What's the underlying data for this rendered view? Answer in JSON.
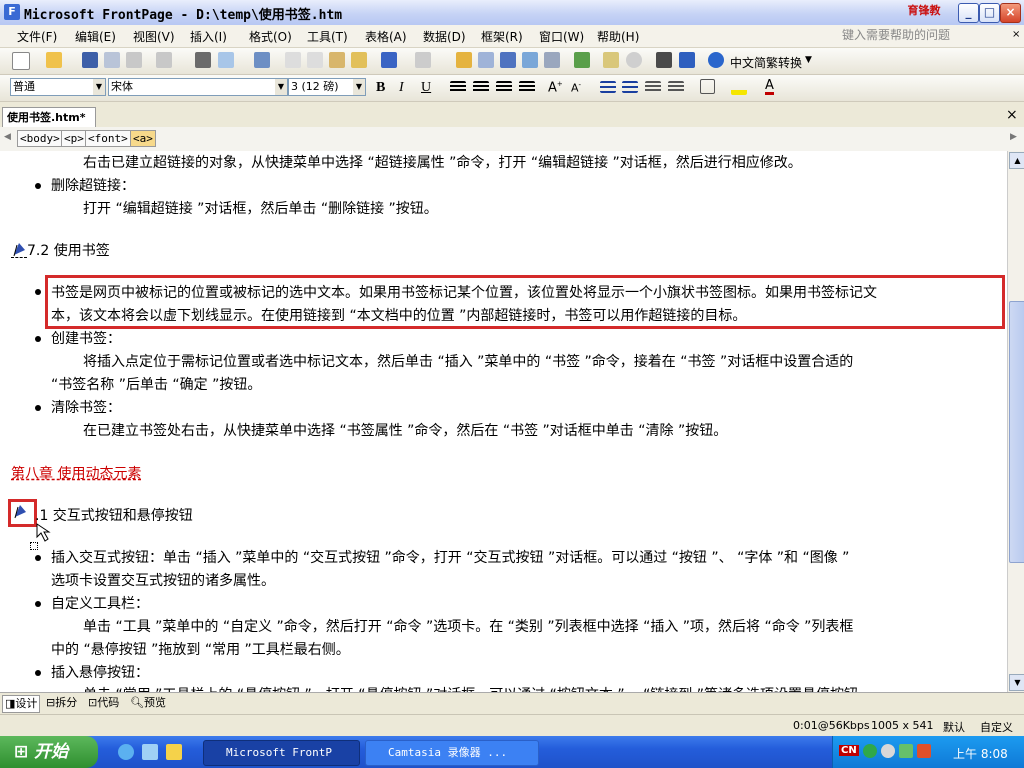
{
  "window": {
    "title": "Microsoft FrontPage - D:\\temp\\使用书签.htm",
    "logo_text": "育锋教",
    "minimize": "_",
    "maximize": "□",
    "close": "×"
  },
  "menu": {
    "items": [
      "文件(F)",
      "编辑(E)",
      "视图(V)",
      "插入(I)",
      "格式(O)",
      "工具(T)",
      "表格(A)",
      "数据(D)",
      "框架(R)",
      "窗口(W)",
      "帮助(H)"
    ],
    "help_placeholder": "键入需要帮助的问题"
  },
  "toolbar": {
    "convert_label": "中文简繁转换",
    "style_value": "普通",
    "font_value": "宋体",
    "size_value": "3 (12 磅)"
  },
  "document": {
    "tab_label": "使用书签.htm*",
    "tags": [
      "<body>",
      "<p>",
      "<font>",
      "<a>"
    ],
    "lines": [
      "右击已建立超链接的对象，从快捷菜单中选择 “超链接属性 ”命令，打开 “编辑超链接 ”对话框，然后进行相应修改。",
      "删除超链接：",
      "打开 “编辑超链接 ”对话框，然后单击 “删除链接 ”按钮。",
      "7.2 使用书签",
      "书签是网页中被标记的位置或被标记的选中文本。如果用书签标记某个位置，该位置处将显示一个小旗状书签图标。如果用书签标记文",
      "本，该文本将会以虚下划线显示。在使用链接到 “本文档中的位置 ”内部超链接时，书签可以用作超链接的目标。",
      "创建书签：",
      "将插入点定位于需标记位置或者选中标记文本，然后单击 “插入 ”菜单中的 “书签 ”命令，接着在 “书签 ”对话框中设置合适的",
      "“书签名称 ”后单击 “确定 ”按钮。",
      "清除书签：",
      "在已建立书签处右击，从快捷菜单中选择 “书签属性 ”命令，然后在 “书签 ”对话框中单击 “清除 ”按钮。",
      "第八章 使用动态元素",
      ".1 交互式按钮和悬停按钮",
      "插入交互式按钮：单击 “插入 ”菜单中的 “交互式按钮 ”命令，打开 “交互式按钮 ”对话框。可以通过 “按钮 ”、 “字体 ”和 “图像 ”",
      "选项卡设置交互式按钮的诸多属性。",
      "自定义工具栏：",
      "单击 “工具 ”菜单中的 “自定义 ”命令，然后打开 “命令 ”选项卡。在 “类别 ”列表框中选择 “插入 ”项，然后将 “命令 ”列表框",
      "中的 “悬停按钮 ”拖放到 “常用 ”工具栏最右侧。",
      "插入悬停按钮：",
      "单击 “常用 ”工具栏上的 “悬停按钮 ”，打开 “悬停按钮 ”对话框，可以通过 “按钮文本 ”、 “链接到 ”等诸多选项设置悬停按钮"
    ]
  },
  "views": [
    "设计",
    "拆分",
    "代码",
    "预览"
  ],
  "status": {
    "speed": "0:01@56Kbps",
    "size": "1005 x 541",
    "mode1": "默认",
    "mode2": "自定义"
  },
  "taskbar": {
    "start_label": "开始",
    "task1": "Microsoft FrontP",
    "task2": "Camtasia 录像器 ...",
    "lang": "CN",
    "clock": "上午 8:08"
  },
  "colors": {
    "highlight_box": "#d42a2a",
    "chapter_red": "#cc0000"
  }
}
